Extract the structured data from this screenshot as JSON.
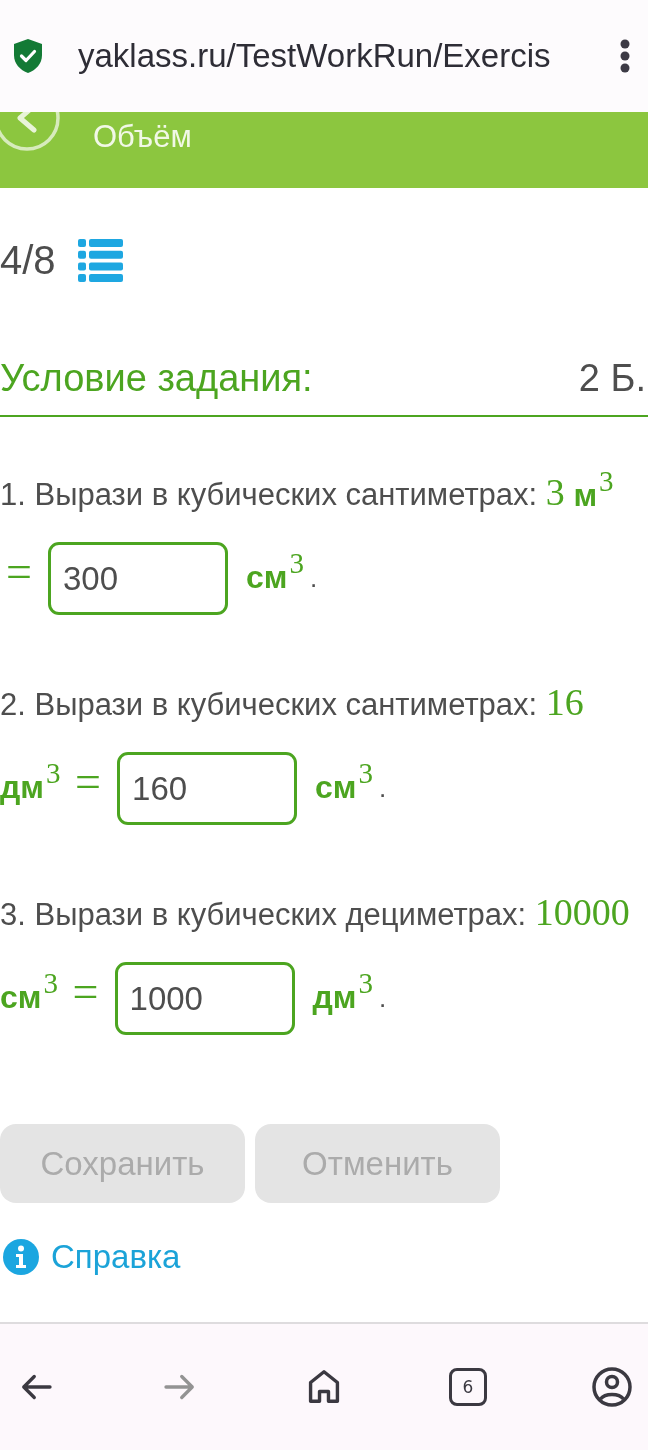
{
  "browser_bar": {
    "url": "yaklass.ru/TestWorkRun/Exercis"
  },
  "banner": {
    "title": "Объём"
  },
  "progress": {
    "counter": "4/8"
  },
  "task": {
    "heading": "Условие задания:",
    "points": "2 Б."
  },
  "questions": [
    {
      "prompt": "1. Вырази в кубических сантиметрах:",
      "given_number": "3",
      "given_unit": "м$^{3}$",
      "equals": "=",
      "answer": "300",
      "answer_unit": "см$^{3}$",
      "end": "."
    },
    {
      "prompt": "2. Вырази в кубических сантиметрах:",
      "given_number": "16",
      "given_unit": "дм$^{3}$",
      "equals": "=",
      "answer": "160",
      "answer_unit": "см$^{3}$",
      "end": "."
    },
    {
      "prompt": "3. Вырази в кубических дециметрах:",
      "given_number": "10000",
      "given_unit": "см$^{3}$",
      "equals": "=",
      "answer": "1000",
      "answer_unit": "дм$^{3}$",
      "end": "."
    }
  ],
  "buttons": [
    {
      "label": "Сохранить",
      "disabled": true
    },
    {
      "label": "Отменить",
      "disabled": true
    }
  ],
  "help": {
    "label": "Справка"
  },
  "bottom_nav": {
    "back": {
      "disabled": false
    },
    "forward": {
      "disabled": true
    },
    "tabs": {
      "count": "6"
    }
  }
}
